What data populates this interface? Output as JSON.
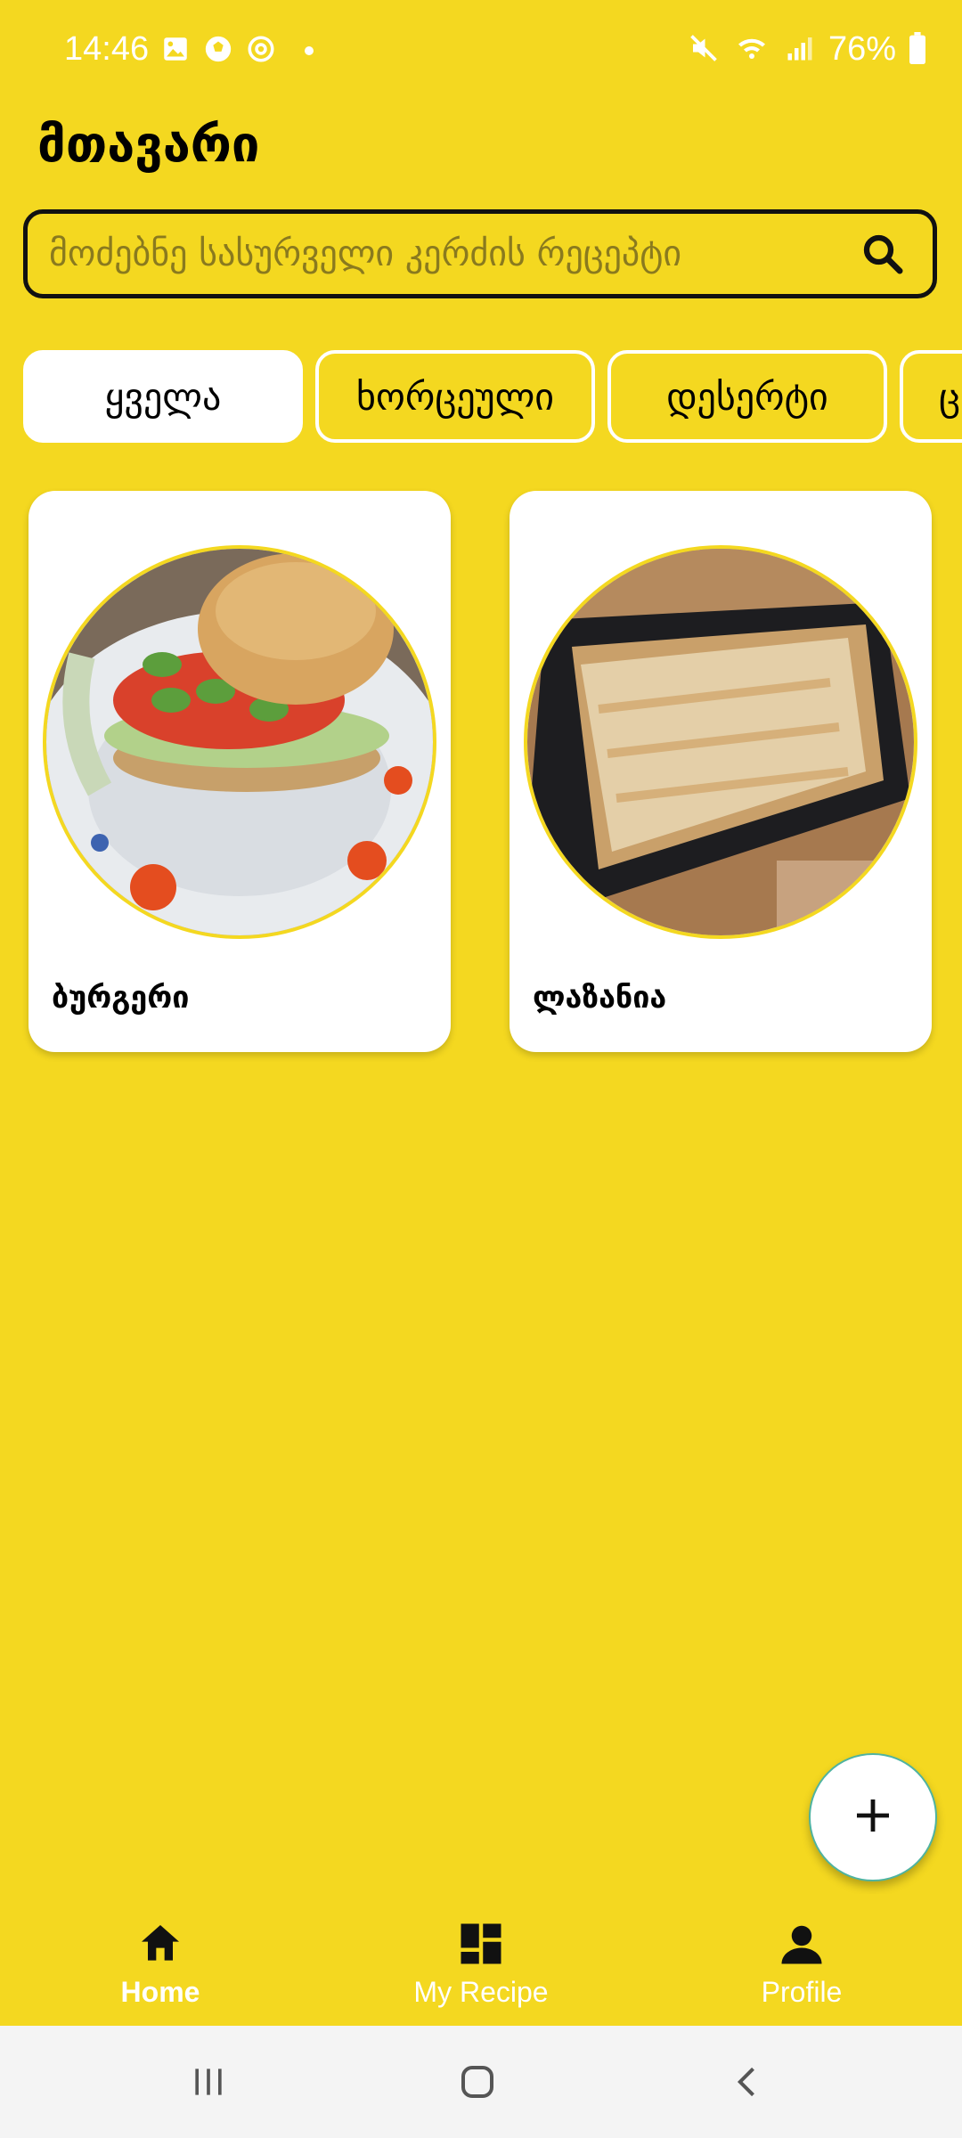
{
  "status_bar": {
    "time": "14:46",
    "battery": "76%",
    "left_icons": [
      "image-icon",
      "ball-icon",
      "threads-icon",
      "dot-icon"
    ],
    "right_icons": [
      "mute-icon",
      "wifi-icon",
      "signal-icon",
      "battery-icon"
    ]
  },
  "header": {
    "title": "მთავარი"
  },
  "search": {
    "placeholder": "მოძებნე სასურველი კერძის რეცეპტი",
    "value": ""
  },
  "categories": [
    {
      "label": "ყველა",
      "active": true
    },
    {
      "label": "ხორცეული",
      "active": false
    },
    {
      "label": "დესერტი",
      "active": false
    },
    {
      "label": "ც",
      "active": false
    }
  ],
  "recipes": [
    {
      "title": "ბურგერი",
      "image": "burger-photo"
    },
    {
      "title": "ლაზანია",
      "image": "lasagna-photo"
    }
  ],
  "fab": {
    "icon": "plus-icon"
  },
  "bottom_nav": [
    {
      "label": "Home",
      "icon": "home-icon",
      "active": true
    },
    {
      "label": "My Recipe",
      "icon": "dashboard-icon",
      "active": false
    },
    {
      "label": "Profile",
      "icon": "person-icon",
      "active": false
    }
  ],
  "system_nav": [
    "recents-icon",
    "home-circle-icon",
    "back-icon"
  ],
  "colors": {
    "background": "#F4D820",
    "card": "#FFFFFF",
    "text": "#000000",
    "nav_text": "#FFFFFF"
  }
}
